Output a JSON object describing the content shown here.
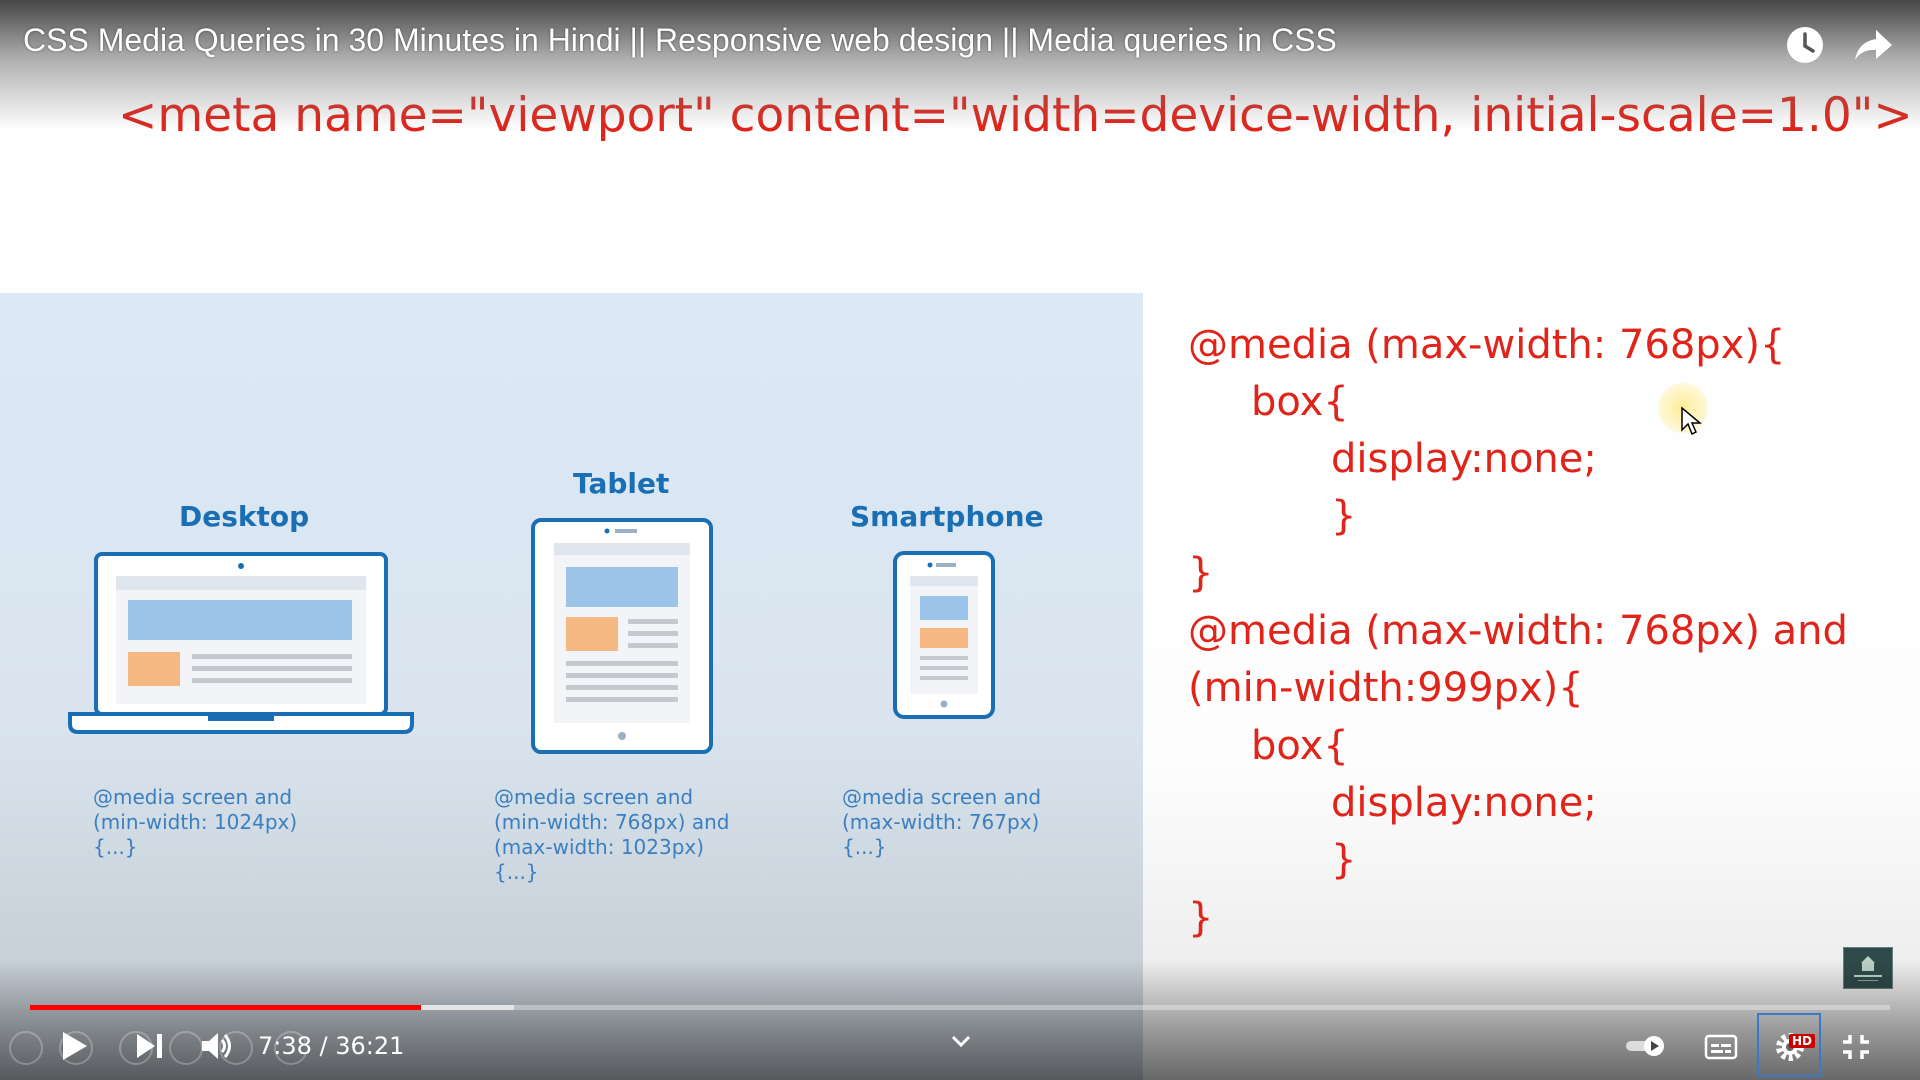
{
  "player": {
    "title": "CSS Media Queries in 30 Minutes in Hindi || Responsive web design || Media queries in CSS",
    "time": "7:38 / 36:21",
    "progress_played": 0.21,
    "progress_buffered": 0.26,
    "hd_badge": "HD",
    "icons": {
      "watch_later": "clock-icon",
      "share": "share-icon",
      "play": "play-icon",
      "next": "skip-next-icon",
      "volume": "volume-icon",
      "autoplay": "autoplay-toggle-icon",
      "captions": "subtitles-icon",
      "settings": "gear-icon",
      "fullscreen": "exit-fullscreen-icon",
      "chapters": "chevron-down-icon"
    }
  },
  "slide": {
    "meta_tag": "<meta name=\"viewport\" content=\"width=device-width, initial-scale=1.0\">",
    "devices": [
      {
        "label": "Desktop",
        "query": [
          "@media screen and",
          "(min-width: 1024px)",
          "{...}"
        ]
      },
      {
        "label": "Tablet",
        "query": [
          "@media screen and",
          "(min-width: 768px) and",
          "(max-width: 1023px)",
          "{...}"
        ]
      },
      {
        "label": "Smartphone",
        "query": [
          "@media screen and",
          "(max-width: 767px)",
          "{...}"
        ]
      }
    ],
    "code_lines": [
      "@media (max-width: 768px){",
      "box{",
      "display:none;",
      "}",
      "}",
      "@media (max-width: 768px) and",
      "(min-width:999px){",
      "box{",
      "display:none;",
      "}",
      "}"
    ]
  },
  "colors": {
    "code_red": "#e0241a",
    "device_blue": "#1a6fb4",
    "progress_red": "#ff0000"
  }
}
